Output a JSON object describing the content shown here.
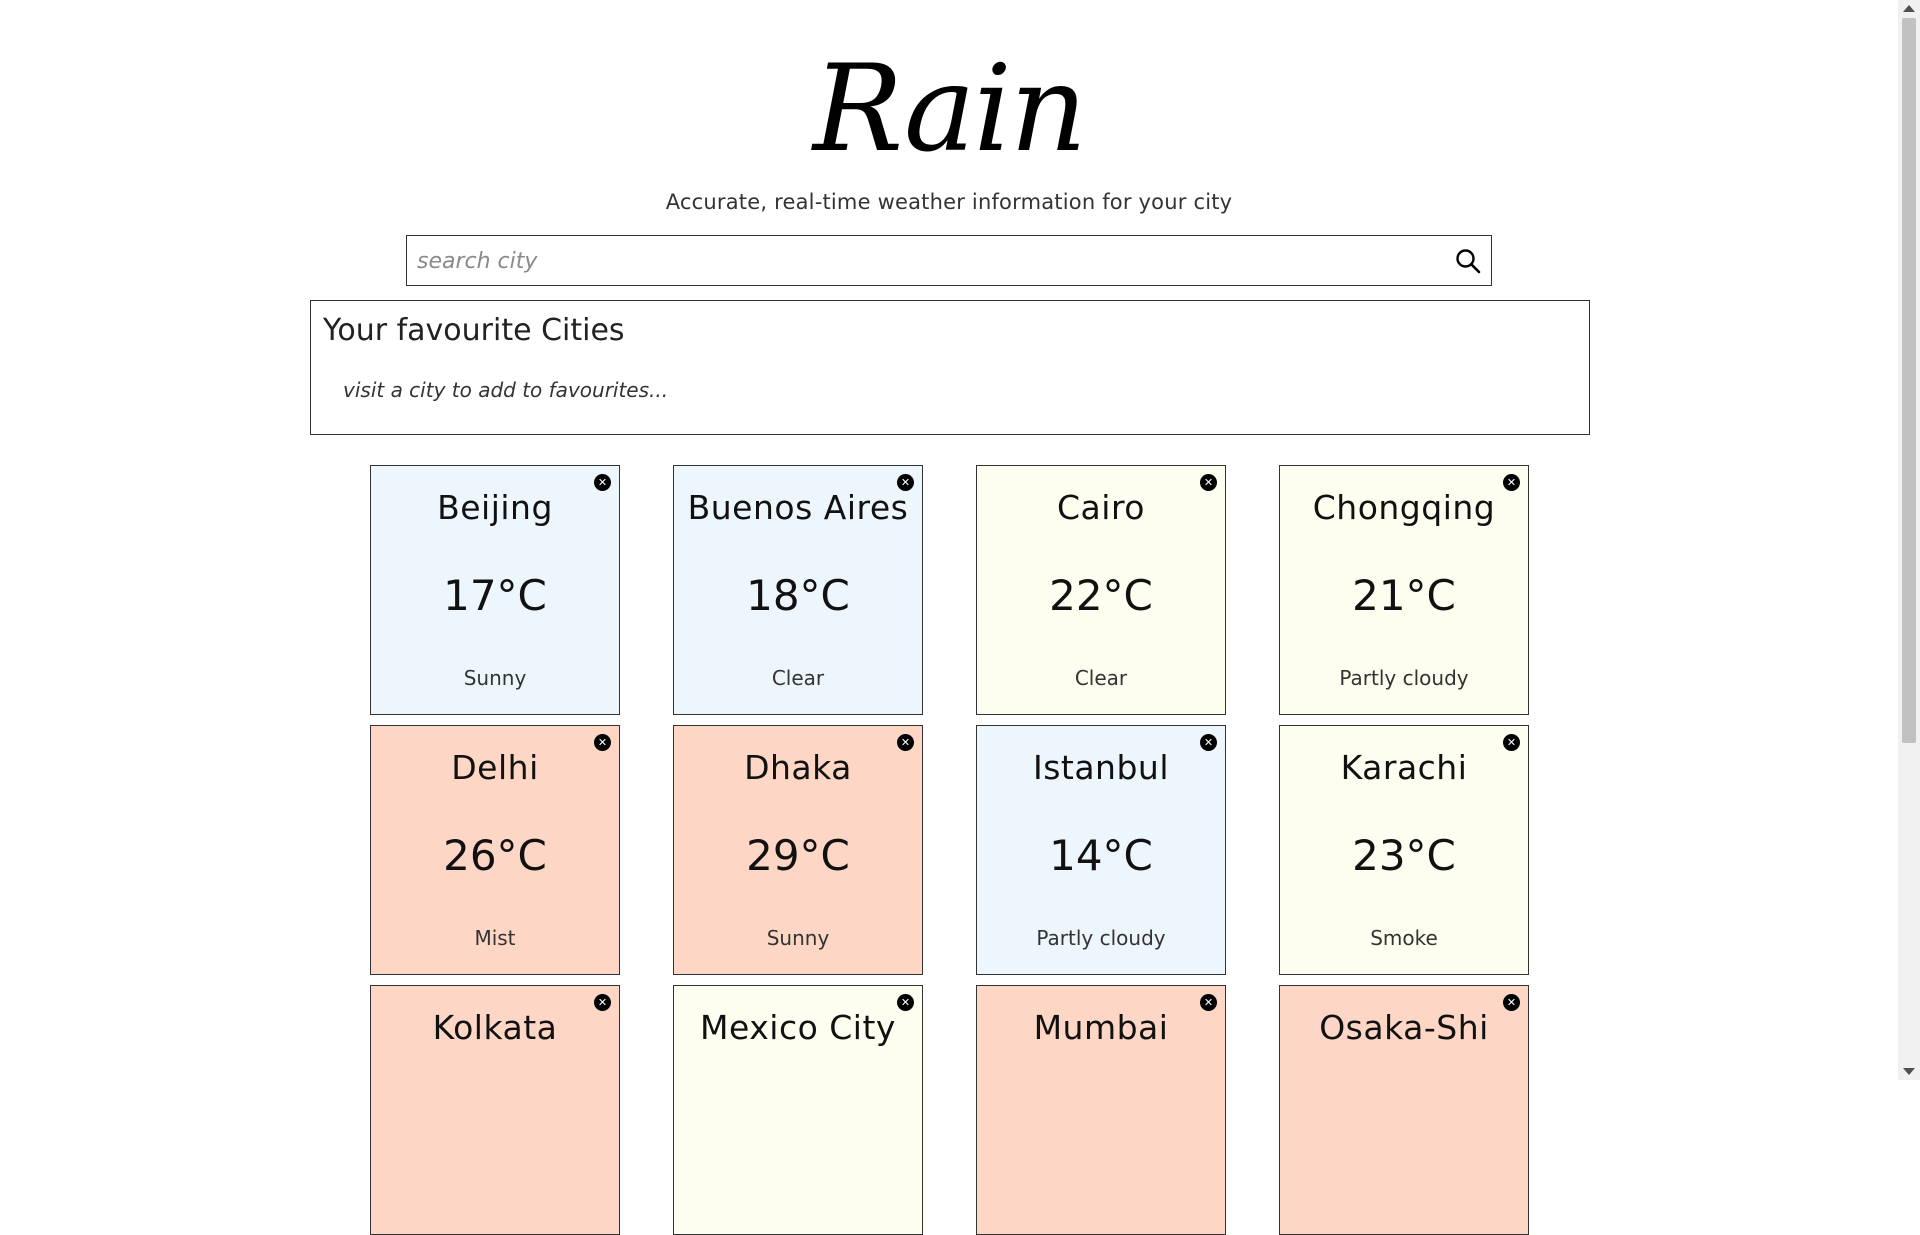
{
  "header": {
    "logo_text": "Rain",
    "tagline": "Accurate, real-time weather information for your city"
  },
  "search": {
    "placeholder": "search city",
    "value": "",
    "icon": "search-icon"
  },
  "favourites": {
    "title": "Your favourite Cities",
    "empty_message": "visit a city to add to favourites..."
  },
  "colors": {
    "cool": "#eef6fd",
    "mild": "#fdfeef",
    "warm": "#fdd6c5"
  },
  "cities": [
    {
      "name": "Beijing",
      "temp": "17°C",
      "condition": "Sunny",
      "tone": "cool"
    },
    {
      "name": "Buenos Aires",
      "temp": "18°C",
      "condition": "Clear",
      "tone": "cool"
    },
    {
      "name": "Cairo",
      "temp": "22°C",
      "condition": "Clear",
      "tone": "mild"
    },
    {
      "name": "Chongqing",
      "temp": "21°C",
      "condition": "Partly cloudy",
      "tone": "mild"
    },
    {
      "name": "Delhi",
      "temp": "26°C",
      "condition": "Mist",
      "tone": "warm"
    },
    {
      "name": "Dhaka",
      "temp": "29°C",
      "condition": "Sunny",
      "tone": "warm"
    },
    {
      "name": "Istanbul",
      "temp": "14°C",
      "condition": "Partly cloudy",
      "tone": "cool"
    },
    {
      "name": "Karachi",
      "temp": "23°C",
      "condition": "Smoke",
      "tone": "mild"
    },
    {
      "name": "Kolkata",
      "temp": "",
      "condition": "",
      "tone": "warm"
    },
    {
      "name": "Mexico City",
      "temp": "",
      "condition": "",
      "tone": "mild"
    },
    {
      "name": "Mumbai",
      "temp": "",
      "condition": "",
      "tone": "warm"
    },
    {
      "name": "Osaka-Shi",
      "temp": "",
      "condition": "",
      "tone": "warm"
    }
  ],
  "card_close_glyph": "✕"
}
